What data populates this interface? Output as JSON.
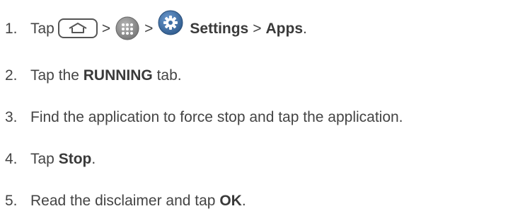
{
  "steps": [
    {
      "number": "1.",
      "text_tap": "Tap",
      "sep1": ">",
      "sep2": ">",
      "settings": "Settings",
      "sep3": ">",
      "apps": "Apps",
      "end": ".",
      "icons": [
        "home-key-icon",
        "apps-icon",
        "settings-gear-icon"
      ]
    },
    {
      "number": "2.",
      "before": "Tap the ",
      "bold": "RUNNING",
      "after": " tab."
    },
    {
      "number": "3.",
      "text": "Find the application to force stop and tap the application."
    },
    {
      "number": "4.",
      "before": "Tap ",
      "bold": "Stop",
      "after": "."
    },
    {
      "number": "5.",
      "before": "Read the disclaimer and tap ",
      "bold": "OK",
      "after": "."
    }
  ],
  "colors": {
    "text": "#444444",
    "apps_icon": "#8a8a8a",
    "settings_icon": "#3f6fa6"
  }
}
